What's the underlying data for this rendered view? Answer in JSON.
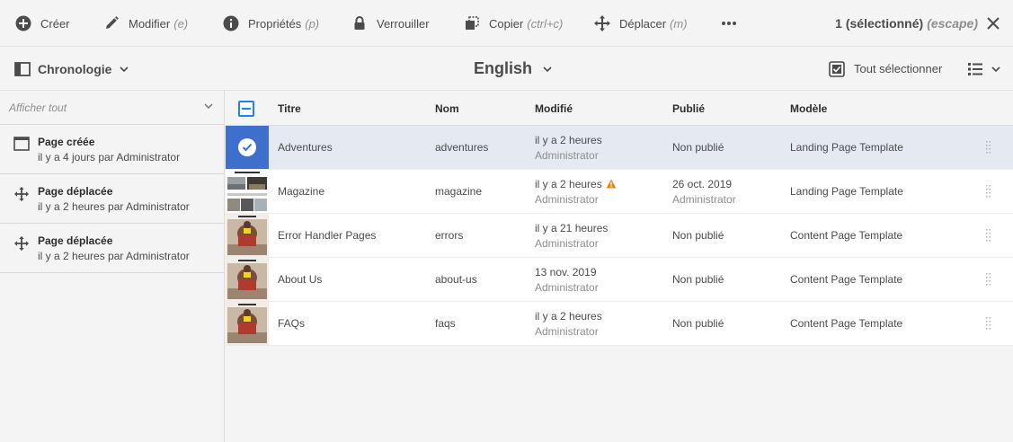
{
  "actionbar": {
    "create": "Créer",
    "modify": "Modifier",
    "modify_key": "(e)",
    "properties": "Propriétés",
    "properties_key": "(p)",
    "lock": "Verrouiller",
    "copy": "Copier",
    "copy_key": "(ctrl+c)",
    "move": "Déplacer",
    "move_key": "(m)",
    "more_icon": "more-icon",
    "selection_count": "1 (sélectionné)",
    "escape_hint": "(escape)"
  },
  "header": {
    "rail_label": "Chronologie",
    "language": "English",
    "select_all": "Tout sélectionner"
  },
  "timeline": {
    "filter_label": "Afficher tout",
    "items": [
      {
        "icon": "page-icon",
        "title": "Page créée",
        "subtitle": "il y a 4 jours par Administrator"
      },
      {
        "icon": "move-icon",
        "title": "Page déplacée",
        "subtitle": "il y a 2 heures par Administrator"
      },
      {
        "icon": "move-icon",
        "title": "Page déplacée",
        "subtitle": "il y a 2 heures par Administrator"
      }
    ]
  },
  "table": {
    "columns": [
      "Titre",
      "Nom",
      "Modifié",
      "Publié",
      "Modèle"
    ],
    "rows": [
      {
        "selected": true,
        "title": "Adventures",
        "name": "adventures",
        "modified": "il y a 2 heures",
        "modified_by": "Administrator",
        "published": "Non publié",
        "published_by": "",
        "template": "Landing Page Template"
      },
      {
        "selected": false,
        "title": "Magazine",
        "name": "magazine",
        "modified": "il y a 2 heures",
        "modified_by": "Administrator",
        "warning": true,
        "published": "26 oct. 2019",
        "published_by": "Administrator",
        "template": "Landing Page Template"
      },
      {
        "selected": false,
        "title": "Error Handler Pages",
        "name": "errors",
        "modified": "il y a 21 heures",
        "modified_by": "Administrator",
        "published": "Non publié",
        "published_by": "",
        "template": "Content Page Template"
      },
      {
        "selected": false,
        "title": "About Us",
        "name": "about-us",
        "modified": "13 nov. 2019",
        "modified_by": "Administrator",
        "published": "Non publié",
        "published_by": "",
        "template": "Content Page Template"
      },
      {
        "selected": false,
        "title": "FAQs",
        "name": "faqs",
        "modified": "il y a 2 heures",
        "modified_by": "Administrator",
        "published": "Non publié",
        "published_by": "",
        "template": "Content Page Template"
      }
    ]
  },
  "colors": {
    "accent": "#2680eb",
    "selected_row": "#e5eaf2",
    "selected_thumb": "#3f6fcd",
    "warning": "#e68619"
  }
}
